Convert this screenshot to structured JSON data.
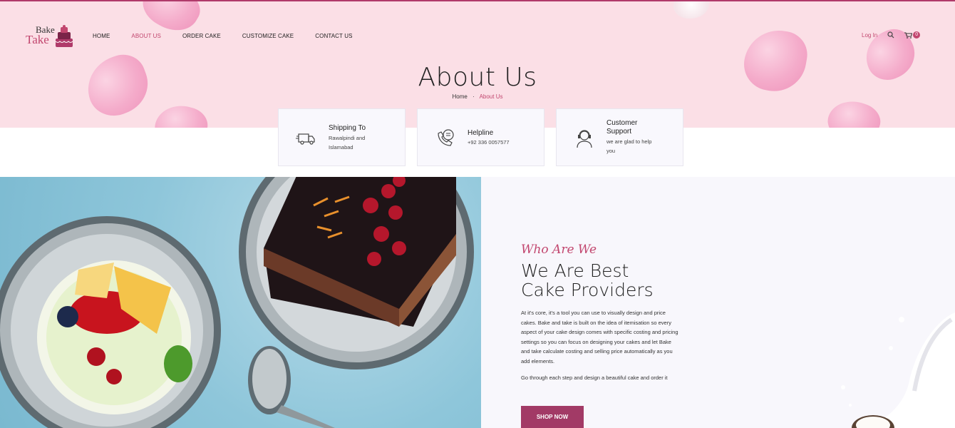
{
  "brand": {
    "line1": "Bake",
    "line2": "Take",
    "amp": "&"
  },
  "nav": {
    "items": [
      "HOME",
      "ABOUT US",
      "ORDER CAKE",
      "CUSTOMIZE CAKE",
      "CONTACT US"
    ],
    "active_index": 1
  },
  "header_right": {
    "login": "Log In",
    "cart_count": "0"
  },
  "hero": {
    "title": "About Us",
    "breadcrumb_home": "Home",
    "breadcrumb_sep": "·",
    "breadcrumb_current": "About Us"
  },
  "cards": [
    {
      "title": "Shipping To",
      "desc1": "Rawalpindi and",
      "desc2": "Islamabad",
      "icon": "delivery-truck-icon"
    },
    {
      "title": "Helpline",
      "desc1": "+92 336 0057577",
      "desc2": "",
      "icon": "phone-chat-icon"
    },
    {
      "title1": "Customer",
      "title2": "Support",
      "desc1": "we are glad to help",
      "desc2": "you",
      "icon": "support-agent-icon"
    }
  ],
  "about": {
    "tagline": "Who Are We",
    "heading1": "We Are Best",
    "heading2": "Cake Providers",
    "para_lines": [
      "At it's core, it's a tool you can use to visually design and price",
      "cakes. Bake and take is built on the idea of itemisation so every",
      "aspect of your cake design comes with specific costing and pricing",
      "settings so you can focus on designing your cakes and let Bake",
      "and take calculate costing and selling price automatically as you",
      "add elements."
    ],
    "para2": "Go through each step and design a beautiful cake and order it",
    "button": "SHOP NOW"
  },
  "colors": {
    "accent": "#c2476f",
    "button": "#a23a66",
    "hero_bg": "#fbdfe6",
    "card_bg": "#f9f8fd"
  }
}
